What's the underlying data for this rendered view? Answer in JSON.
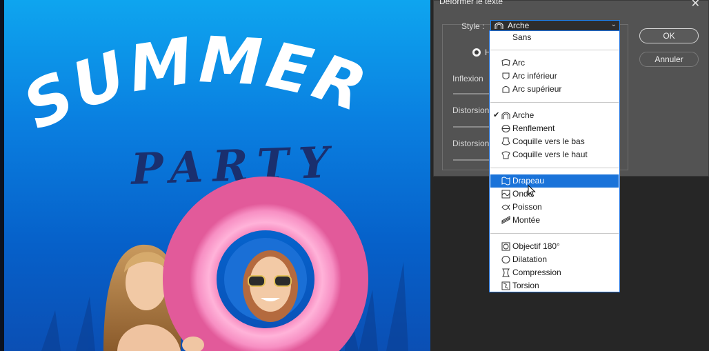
{
  "dialog": {
    "title": "Déformer le texte",
    "style_label": "Style :",
    "style_value": "Arche",
    "orientation_label": "H",
    "params": [
      "Inflexion",
      "Distorsion",
      "Distorsion"
    ],
    "ok_label": "OK",
    "cancel_label": "Annuler"
  },
  "canvas": {
    "headline": "SUMMER",
    "subline": "PARTY"
  },
  "dropdown": {
    "selected": "Arche",
    "highlighted": "Drapeau",
    "items": [
      {
        "label": "Sans",
        "icon": "none"
      },
      {
        "label": "Arc",
        "icon": "arc-icon"
      },
      {
        "label": "Arc inférieur",
        "icon": "arc-lower-icon"
      },
      {
        "label": "Arc supérieur",
        "icon": "arc-upper-icon"
      },
      {
        "label": "Arche",
        "icon": "arch-icon"
      },
      {
        "label": "Renflement",
        "icon": "bulge-icon"
      },
      {
        "label": "Coquille vers le bas",
        "icon": "shell-lower-icon"
      },
      {
        "label": "Coquille vers le haut",
        "icon": "shell-upper-icon"
      },
      {
        "label": "Drapeau",
        "icon": "flag-icon"
      },
      {
        "label": "Onde",
        "icon": "wave-icon"
      },
      {
        "label": "Poisson",
        "icon": "fish-icon"
      },
      {
        "label": "Montée",
        "icon": "rise-icon"
      },
      {
        "label": "Objectif 180°",
        "icon": "fisheye-icon"
      },
      {
        "label": "Dilatation",
        "icon": "inflate-icon"
      },
      {
        "label": "Compression",
        "icon": "squeeze-icon"
      },
      {
        "label": "Torsion",
        "icon": "twist-icon"
      }
    ]
  },
  "colors": {
    "highlight": "#1a73d9",
    "dialog_bg": "#535353",
    "poster_blue": "#0a7fe0",
    "party_navy": "#1a2f6e",
    "ring_pink": "#f78fc3"
  }
}
